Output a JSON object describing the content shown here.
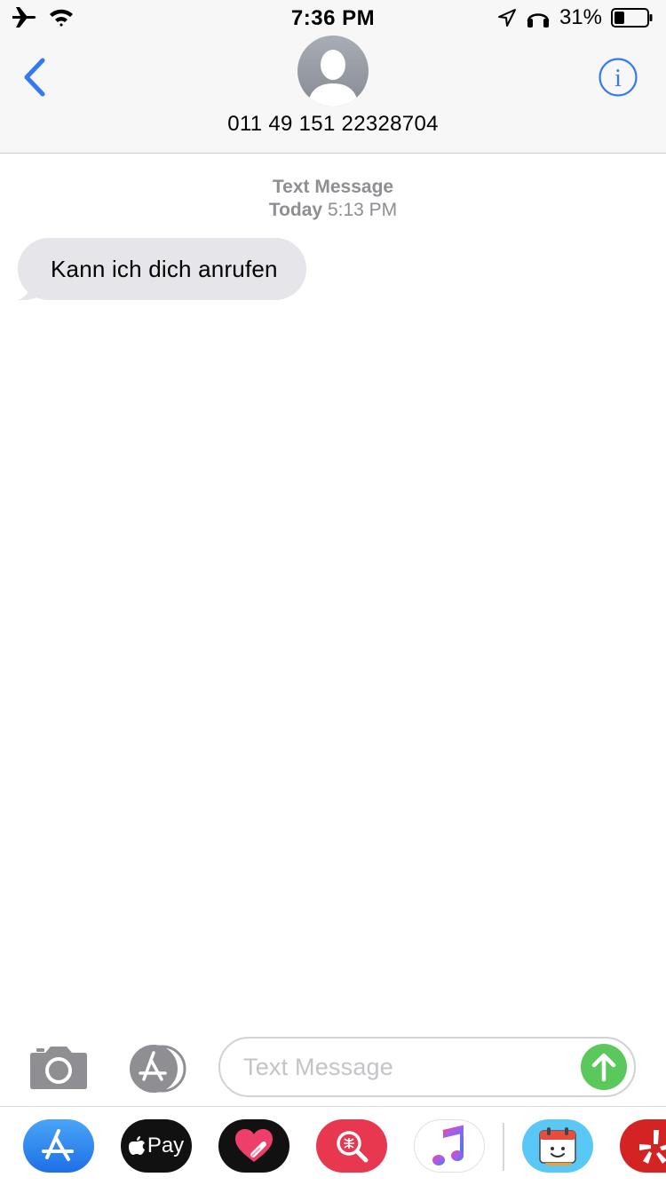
{
  "status_bar": {
    "time": "7:36 PM",
    "battery_percent": "31%",
    "battery_level": 0.31,
    "icons": [
      "airplane-icon",
      "wifi-icon",
      "location-arrow-icon",
      "headphones-icon",
      "battery-icon"
    ]
  },
  "header": {
    "contact": "011 49 151 22328704",
    "back_icon": "chevron-left-icon",
    "info_icon": "info-icon"
  },
  "conversation": {
    "service_label": "Text Message",
    "day": "Today",
    "time": "5:13 PM",
    "messages": [
      {
        "direction": "incoming",
        "text": "Kann ich dich anrufen"
      }
    ]
  },
  "composer": {
    "placeholder": "Text Message",
    "camera_icon": "camera-icon",
    "apps_icon": "app-store-icon",
    "send_icon": "send-arrow-icon"
  },
  "app_drawer": {
    "items": [
      {
        "name": "App Store",
        "icon": "app-store-icon"
      },
      {
        "name": "Apple Pay",
        "label": "Pay",
        "icon": "apple-pay-icon"
      },
      {
        "name": "Digital Touch",
        "icon": "heart-icon"
      },
      {
        "name": "Images",
        "icon": "image-search-icon"
      },
      {
        "name": "Music",
        "icon": "music-note-icon"
      },
      {
        "name": "Stickers",
        "icon": "calendar-sticker-icon"
      },
      {
        "name": "Yelp",
        "icon": "yelp-icon"
      }
    ]
  },
  "colors": {
    "accent": "#3478f6",
    "bubble_incoming": "#e5e5ea",
    "send": "#5ac85a",
    "secondary_text": "#8e8e93",
    "header_bg": "#f7f7f7"
  }
}
